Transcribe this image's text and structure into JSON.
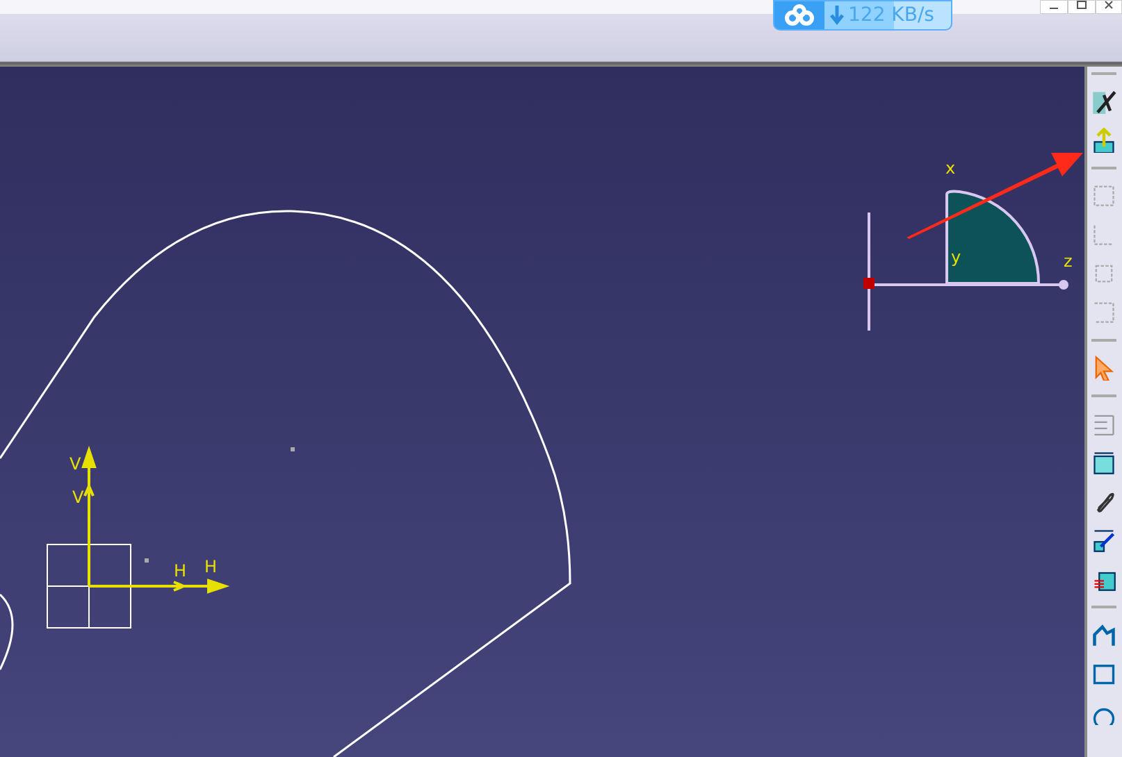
{
  "download_badge": {
    "speed": "122 KB/s"
  },
  "compass": {
    "labels": [
      "x",
      "y",
      "z"
    ]
  },
  "sketch_axes": {
    "labels": [
      "V",
      "V",
      "H",
      "H"
    ]
  }
}
